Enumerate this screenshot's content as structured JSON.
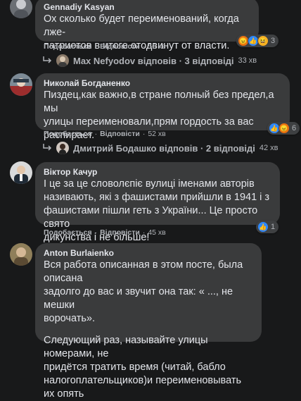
{
  "comments": [
    {
      "author": "Gennadiy Kasyan",
      "text": [
        "Ох сколько будет переименований, когда лже-",
        "патриотов в итоге отодвинут от власти."
      ],
      "like": "Подобається",
      "reply": "Відповісти",
      "time": "56 хв",
      "reaction_count": "3",
      "reactions": [
        "angry",
        "like",
        "haha"
      ]
    },
    {
      "author": "Николай Богданенко",
      "text": [
        "Пиздец,как важно,в стране полный без предел,а мы",
        "улицы переименовали,прям гордость за вас",
        "распирает."
      ],
      "like": "Подобається",
      "reply": "Відповісти",
      "time": "52 хв",
      "reaction_count": "6",
      "reactions": [
        "like",
        "angry"
      ]
    },
    {
      "author": "Віктор Качур",
      "text": [
        "І це за це словолєпіє вулиці іменами авторів",
        "називають, які з фашистами прийшли в 1941 і з",
        "фашистами пішли геть з України... Це просто свято",
        "дикунства і не більше!"
      ],
      "like": "Подобається",
      "reply": "Відповісти",
      "time": "45 хв",
      "reaction_count": "1",
      "reactions": [
        "like"
      ]
    },
    {
      "author": "Anton Burlaienko",
      "text": [
        "Вся работа описанная в этом посте, была описана",
        "задолго до вас и звучит она так: « ..., не мешки",
        "ворочать»."
      ],
      "text2": [
        "Следующий раз, называйте улицы номерами, не",
        "придётся тратить время (читай, бабло",
        "налогоплательщиков)и переименовывать их опять"
      ]
    }
  ],
  "reply_threads": [
    {
      "text": "Max Nefyodov відповів · 3 відповіді",
      "time": "33 хв"
    },
    {
      "text": "Дмитрий Бодашко відповів · 2 відповіді",
      "time": "42 хв"
    }
  ],
  "colors": {
    "background": "#18191a",
    "bubble": "#3a3b3c",
    "like_blue": "#2d88ff",
    "angry_orange": "#e9710f",
    "muted": "#b0b3b8"
  }
}
